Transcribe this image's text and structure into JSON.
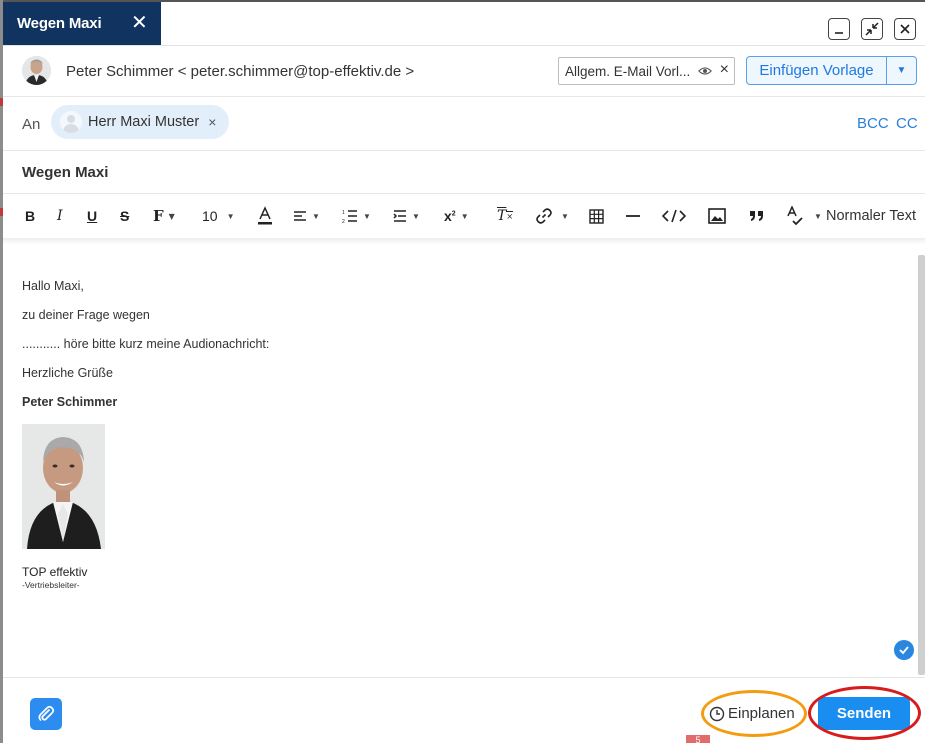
{
  "tab": {
    "title": "Wegen Maxi",
    "close": "✕"
  },
  "window": {
    "minimize": "_",
    "restore": "⤡",
    "close": "✕"
  },
  "sender": {
    "display": "Peter Schimmer < peter.schimmer@top-effektiv.de >"
  },
  "template": {
    "selected": "Allgem. E-Mail Vorl...",
    "insert_label": "Einfügen Vorlage"
  },
  "recipients": {
    "to_label": "An",
    "chips": [
      {
        "name": "Herr Maxi Muster"
      }
    ],
    "bcc_label": "BCC",
    "cc_label": "CC"
  },
  "subject": "Wegen Maxi",
  "toolbar": {
    "font_size": "10",
    "text_style": "Normaler Text",
    "icons": [
      "bold-icon",
      "italic-icon",
      "underline-icon",
      "strikethrough-icon",
      "font-family-icon",
      "font-size-dropdown",
      "text-color-icon",
      "align-icon",
      "numbered-list-icon",
      "indent-icon",
      "superscript-icon",
      "clear-format-icon",
      "link-icon",
      "table-icon",
      "horizontal-rule-icon",
      "code-icon",
      "image-icon",
      "quote-icon",
      "spellcheck-icon"
    ]
  },
  "body": {
    "greeting": "Hallo Maxi,",
    "line1": "zu deiner Frage wegen",
    "line2": "........... höre bitte kurz meine Audionachricht:",
    "closing": "Herzliche Grüße",
    "signature_name": "Peter Schimmer",
    "company": "TOP effektiv",
    "role": "-Vertriebsleiter-"
  },
  "footer": {
    "schedule_label": "Einplanen",
    "send_label": "Senden",
    "badge": "5"
  },
  "colors": {
    "tab_bg": "#10345f",
    "accent": "#1a8df0",
    "annotation_orange": "#f39c12",
    "annotation_red": "#d81b1b"
  }
}
